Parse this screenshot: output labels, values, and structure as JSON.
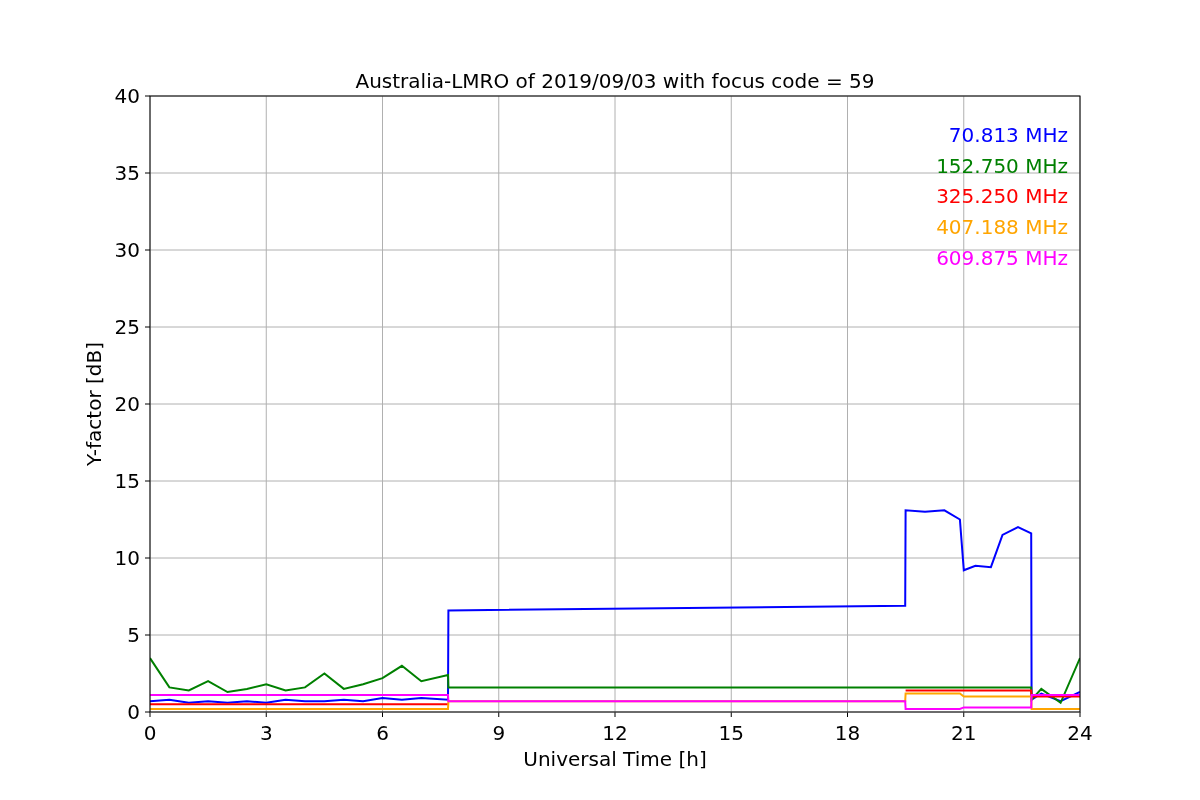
{
  "chart_data": {
    "type": "line",
    "title": "Australia-LMRO of 2019/09/03 with focus code = 59",
    "xlabel": "Universal Time [h]",
    "ylabel": "Y-factor [dB]",
    "x": [
      0,
      0.5,
      1,
      1.5,
      2,
      2.5,
      3,
      3.5,
      4,
      4.5,
      5,
      5.5,
      6,
      6.5,
      7,
      7.69,
      7.7,
      19.49,
      19.5,
      20,
      20.5,
      20.9,
      21,
      21.3,
      21.7,
      22,
      22.4,
      22.74,
      22.75,
      23,
      23.5,
      24
    ],
    "series": [
      {
        "name": "70.813 MHz",
        "color": "#0000ff",
        "values": [
          0.7,
          0.8,
          0.6,
          0.7,
          0.6,
          0.7,
          0.6,
          0.8,
          0.7,
          0.7,
          0.8,
          0.7,
          0.9,
          0.8,
          0.9,
          0.8,
          6.6,
          6.9,
          13.1,
          13.0,
          13.1,
          12.5,
          9.2,
          9.5,
          9.4,
          11.5,
          12.0,
          11.6,
          0.8,
          1.2,
          0.7,
          1.3
        ]
      },
      {
        "name": "152.750 MHz",
        "color": "#008000",
        "values": [
          3.5,
          1.6,
          1.4,
          2.0,
          1.3,
          1.5,
          1.8,
          1.4,
          1.6,
          2.5,
          1.5,
          1.8,
          2.2,
          3.0,
          2.0,
          2.4,
          1.6,
          1.6,
          1.6,
          1.6,
          1.6,
          1.6,
          1.6,
          1.6,
          1.6,
          1.6,
          1.6,
          1.6,
          0.8,
          1.5,
          0.6,
          3.5
        ]
      },
      {
        "name": "325.250 MHz",
        "color": "#ff0000",
        "values": [
          0.5,
          0.5,
          0.5,
          0.5,
          0.5,
          0.5,
          0.5,
          0.5,
          0.5,
          0.5,
          0.5,
          0.5,
          0.5,
          0.5,
          0.5,
          0.5,
          null,
          null,
          1.4,
          1.4,
          1.4,
          1.4,
          1.4,
          1.4,
          1.4,
          1.4,
          1.4,
          1.4,
          1.0,
          1.0,
          1.0,
          1.0
        ]
      },
      {
        "name": "407.188 MHz",
        "color": "#ffa500",
        "values": [
          0.2,
          0.2,
          0.2,
          0.2,
          0.2,
          0.2,
          0.2,
          0.2,
          0.2,
          0.2,
          0.2,
          0.2,
          0.2,
          0.2,
          0.2,
          0.2,
          0.7,
          0.7,
          1.2,
          1.2,
          1.2,
          1.2,
          1.0,
          1.0,
          1.0,
          1.0,
          1.0,
          1.0,
          0.2,
          0.2,
          0.2,
          0.2
        ]
      },
      {
        "name": "609.875 MHz",
        "color": "#ff00ff",
        "values": [
          1.1,
          1.1,
          1.1,
          1.1,
          1.1,
          1.1,
          1.1,
          1.1,
          1.1,
          1.1,
          1.1,
          1.1,
          1.1,
          1.1,
          1.1,
          1.1,
          0.7,
          0.7,
          0.2,
          0.2,
          0.2,
          0.2,
          0.3,
          0.3,
          0.3,
          0.3,
          0.3,
          0.3,
          1.1,
          1.1,
          1.1,
          1.1
        ]
      }
    ],
    "grid": true,
    "xlim": [
      0,
      24
    ],
    "ylim": [
      0,
      40
    ],
    "xticks": [
      0,
      3,
      6,
      9,
      12,
      15,
      18,
      21,
      24
    ],
    "yticks": [
      0,
      5,
      10,
      15,
      20,
      25,
      30,
      35,
      40
    ]
  }
}
